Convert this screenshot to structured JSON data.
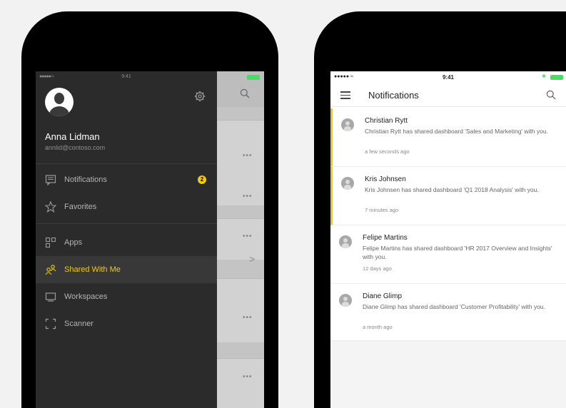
{
  "drawer": {
    "status_time": "9:41",
    "user": {
      "name": "Anna Lidman",
      "email": "annlid@contoso.com"
    },
    "items": [
      {
        "label": "Notifications",
        "icon": "notifications-icon",
        "badge": "2"
      },
      {
        "label": "Favorites",
        "icon": "star-icon"
      },
      {
        "label": "Apps",
        "icon": "apps-icon"
      },
      {
        "label": "Shared With Me",
        "icon": "shared-icon",
        "active": true
      },
      {
        "label": "Workspaces",
        "icon": "workspaces-icon"
      },
      {
        "label": "Scanner",
        "icon": "scanner-icon"
      }
    ],
    "more_label": "•••",
    "accent": "#f2c811"
  },
  "notifications_screen": {
    "status_time": "9:41",
    "title": "Notifications",
    "items": [
      {
        "name": "Christian Rytt",
        "message": "Christian Rytt has shared dashboard 'Sales and Marketing' with you.",
        "time": "a few seconds ago",
        "unread": true
      },
      {
        "name": "Kris Johnsen",
        "message": "Kris Johnsen has shared dashboard 'Q1 2018 Analysis' with you.",
        "time": "7 minutes ago",
        "unread": true
      },
      {
        "name": "Felipe Martins",
        "message": "Felipe Martins has shared dashboard 'HR 2017 Overview and Insights' with you.",
        "time": "12 days ago",
        "unread": false
      },
      {
        "name": "Diane Glimp",
        "message": "Diane Glimp has shared dashboard 'Customer Profitability' with you.",
        "time": "a month ago",
        "unread": false
      }
    ]
  }
}
